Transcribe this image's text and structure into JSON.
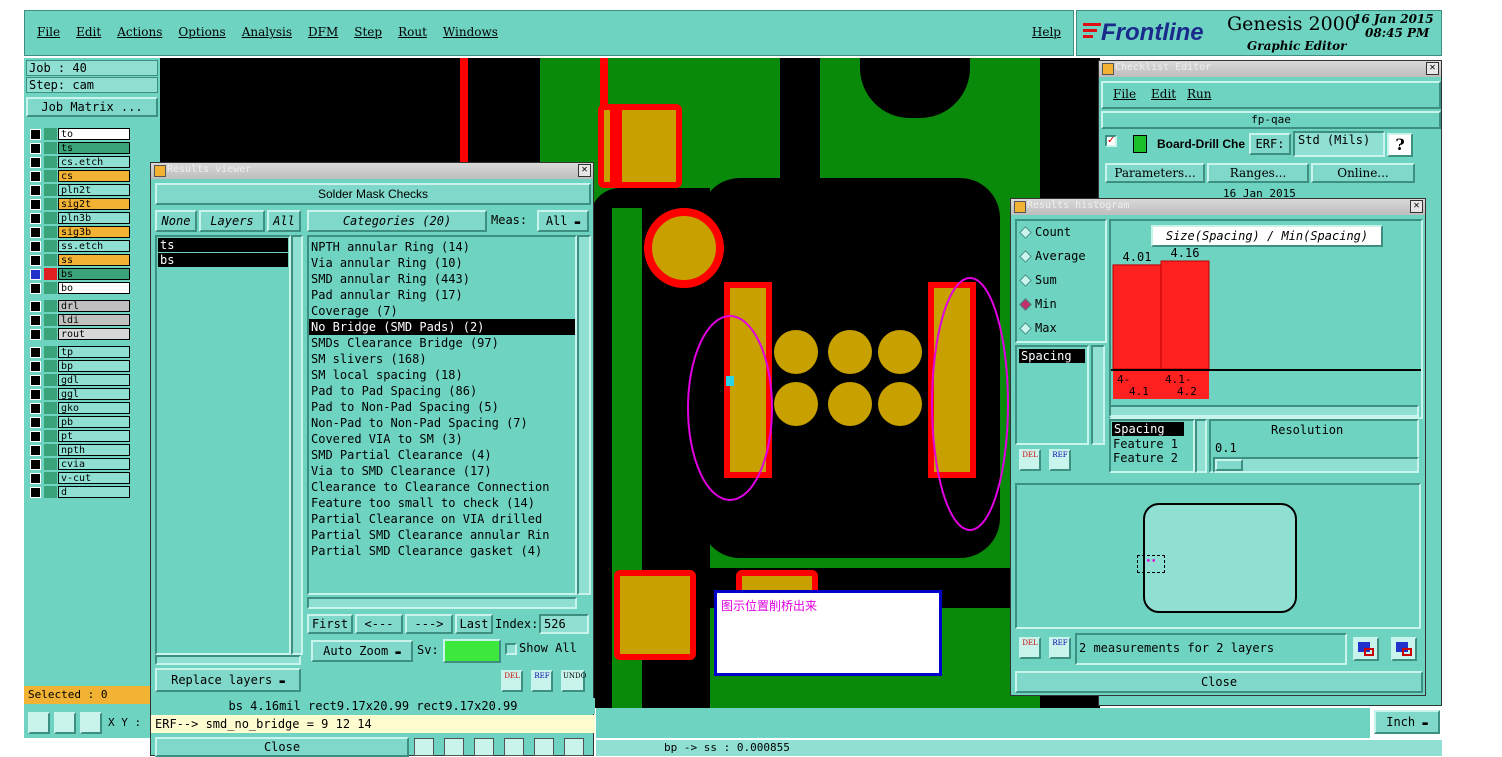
{
  "menubar": {
    "items": [
      "File",
      "Edit",
      "Actions",
      "Options",
      "Analysis",
      "DFM",
      "Step",
      "Rout",
      "Windows"
    ],
    "help": "Help"
  },
  "brand": {
    "logo": "Frontline",
    "product": "Genesis 2000",
    "subtitle": "Graphic Editor",
    "date": "16 Jan 2015",
    "time": "08:45 PM"
  },
  "job": {
    "job": "Job : 40",
    "step": "Step: cam",
    "matrix": "Job Matrix ..."
  },
  "layers": [
    {
      "name": "to",
      "color": "#ffffff"
    },
    {
      "name": "ts",
      "color": "#3aa37a"
    },
    {
      "name": "cs.etch",
      "color": "#8fdfd2"
    },
    {
      "name": "cs",
      "color": "#f2b233"
    },
    {
      "name": "pln2t",
      "color": "#8fdfd2"
    },
    {
      "name": "sig2t",
      "color": "#f2b233"
    },
    {
      "name": "pln3b",
      "color": "#8fdfd2"
    },
    {
      "name": "sig3b",
      "color": "#f2b233"
    },
    {
      "name": "ss.etch",
      "color": "#8fdfd2"
    },
    {
      "name": "ss",
      "color": "#f2b233"
    },
    {
      "name": "bs",
      "color": "#3aa37a"
    },
    {
      "name": "bo",
      "color": "#ffffff"
    },
    {
      "name": "drl",
      "color": "#c0c0c0"
    },
    {
      "name": "ldi",
      "color": "#c0c0c0"
    },
    {
      "name": "rout",
      "color": "#d8d8d8"
    },
    {
      "name": "tp",
      "color": "#8fdfd2"
    },
    {
      "name": "bp",
      "color": "#8fdfd2"
    },
    {
      "name": "gdl",
      "color": "#8fdfd2"
    },
    {
      "name": "ggl",
      "color": "#8fdfd2"
    },
    {
      "name": "gko",
      "color": "#8fdfd2"
    },
    {
      "name": "pb",
      "color": "#8fdfd2"
    },
    {
      "name": "pt",
      "color": "#8fdfd2"
    },
    {
      "name": "npth",
      "color": "#8fdfd2"
    },
    {
      "name": "cvia",
      "color": "#8fdfd2"
    },
    {
      "name": "v-cut",
      "color": "#8fdfd2"
    },
    {
      "name": "d",
      "color": "#8fdfd2"
    }
  ],
  "selected": "Selected : 0",
  "xy_label": "X Y :",
  "results_viewer": {
    "title": "Results viewer",
    "header": "Solder Mask Checks",
    "none_btn": "None",
    "layers_btn": "Layers",
    "all_btn": "All",
    "layer_list": [
      "ts",
      "bs"
    ],
    "categories_btn": "Categories (20)",
    "meas_label": "Meas:",
    "meas_value": "All",
    "categories": [
      "NPTH annular Ring (14)",
      "Via annular Ring (10)",
      "SMD annular Ring (443)",
      "Pad annular Ring (17)",
      "Coverage (7)",
      "No Bridge (SMD Pads) (2)",
      "SMDs Clearance Bridge (97)",
      "SM slivers (168)",
      "SM local spacing (18)",
      "Pad to Pad Spacing (86)",
      "Pad to Non-Pad Spacing (5)",
      "Non-Pad to Non-Pad Spacing (7)",
      "Covered VIA to SM (3)",
      "SMD Partial Clearance (4)",
      "Via to SMD Clearance (17)",
      "Clearance to Clearance Connection",
      "Feature too small to check (14)",
      "Partial Clearance on VIA drilled",
      "Partial SMD Clearance annular Rin",
      "Partial SMD Clearance gasket (4)"
    ],
    "first": "First",
    "prev": "<---",
    "next": "--->",
    "last": "Last",
    "index_label": "Index:",
    "index_value": "526",
    "auto_zoom": "Auto Zoom",
    "sv_label": "Sv:",
    "show_all": "Show All",
    "replace_layers": "Replace layers",
    "status": "bs 4.16mil  rect9.17x20.99  rect9.17x20.99",
    "erf": "ERF--> smd_no_bridge = 9 12 14",
    "close": "Close"
  },
  "checklist": {
    "title": "Checklist Editor",
    "menu": [
      "File",
      "Edit",
      "Run"
    ],
    "name": "fp-qae",
    "row_label": "Board-Drill Che",
    "erf_btn": "ERF:",
    "erf_value": "Std (Mils)",
    "help_btn": "?",
    "parameters": "Parameters...",
    "ranges": "Ranges...",
    "online": "Online...",
    "date": "16 Jan 2015"
  },
  "histogram": {
    "title": "Results histogram",
    "options": [
      "Count",
      "Average",
      "Sum",
      "Min",
      "Max"
    ],
    "selected_option": "Min",
    "chart_title": "Size(Spacing) / Min(Spacing)",
    "measure_list": [
      "Spacing"
    ],
    "attr_list": [
      "Spacing",
      "Feature 1",
      "Feature 2"
    ],
    "resolution_label": "Resolution",
    "resolution_value": "0.1",
    "measurements": "2 measurements for 2 layers",
    "close": "Close"
  },
  "chart_data": {
    "type": "bar",
    "title": "Size(Spacing) / Min(Spacing)",
    "categories": [
      "4-4.1",
      "4.1-4.2"
    ],
    "values": [
      4.01,
      4.16
    ],
    "color": "#ff2020"
  },
  "annotation": "图示位置削桥出来",
  "units": "Inch",
  "bottom_status": "bp -> ss : 0.000855"
}
